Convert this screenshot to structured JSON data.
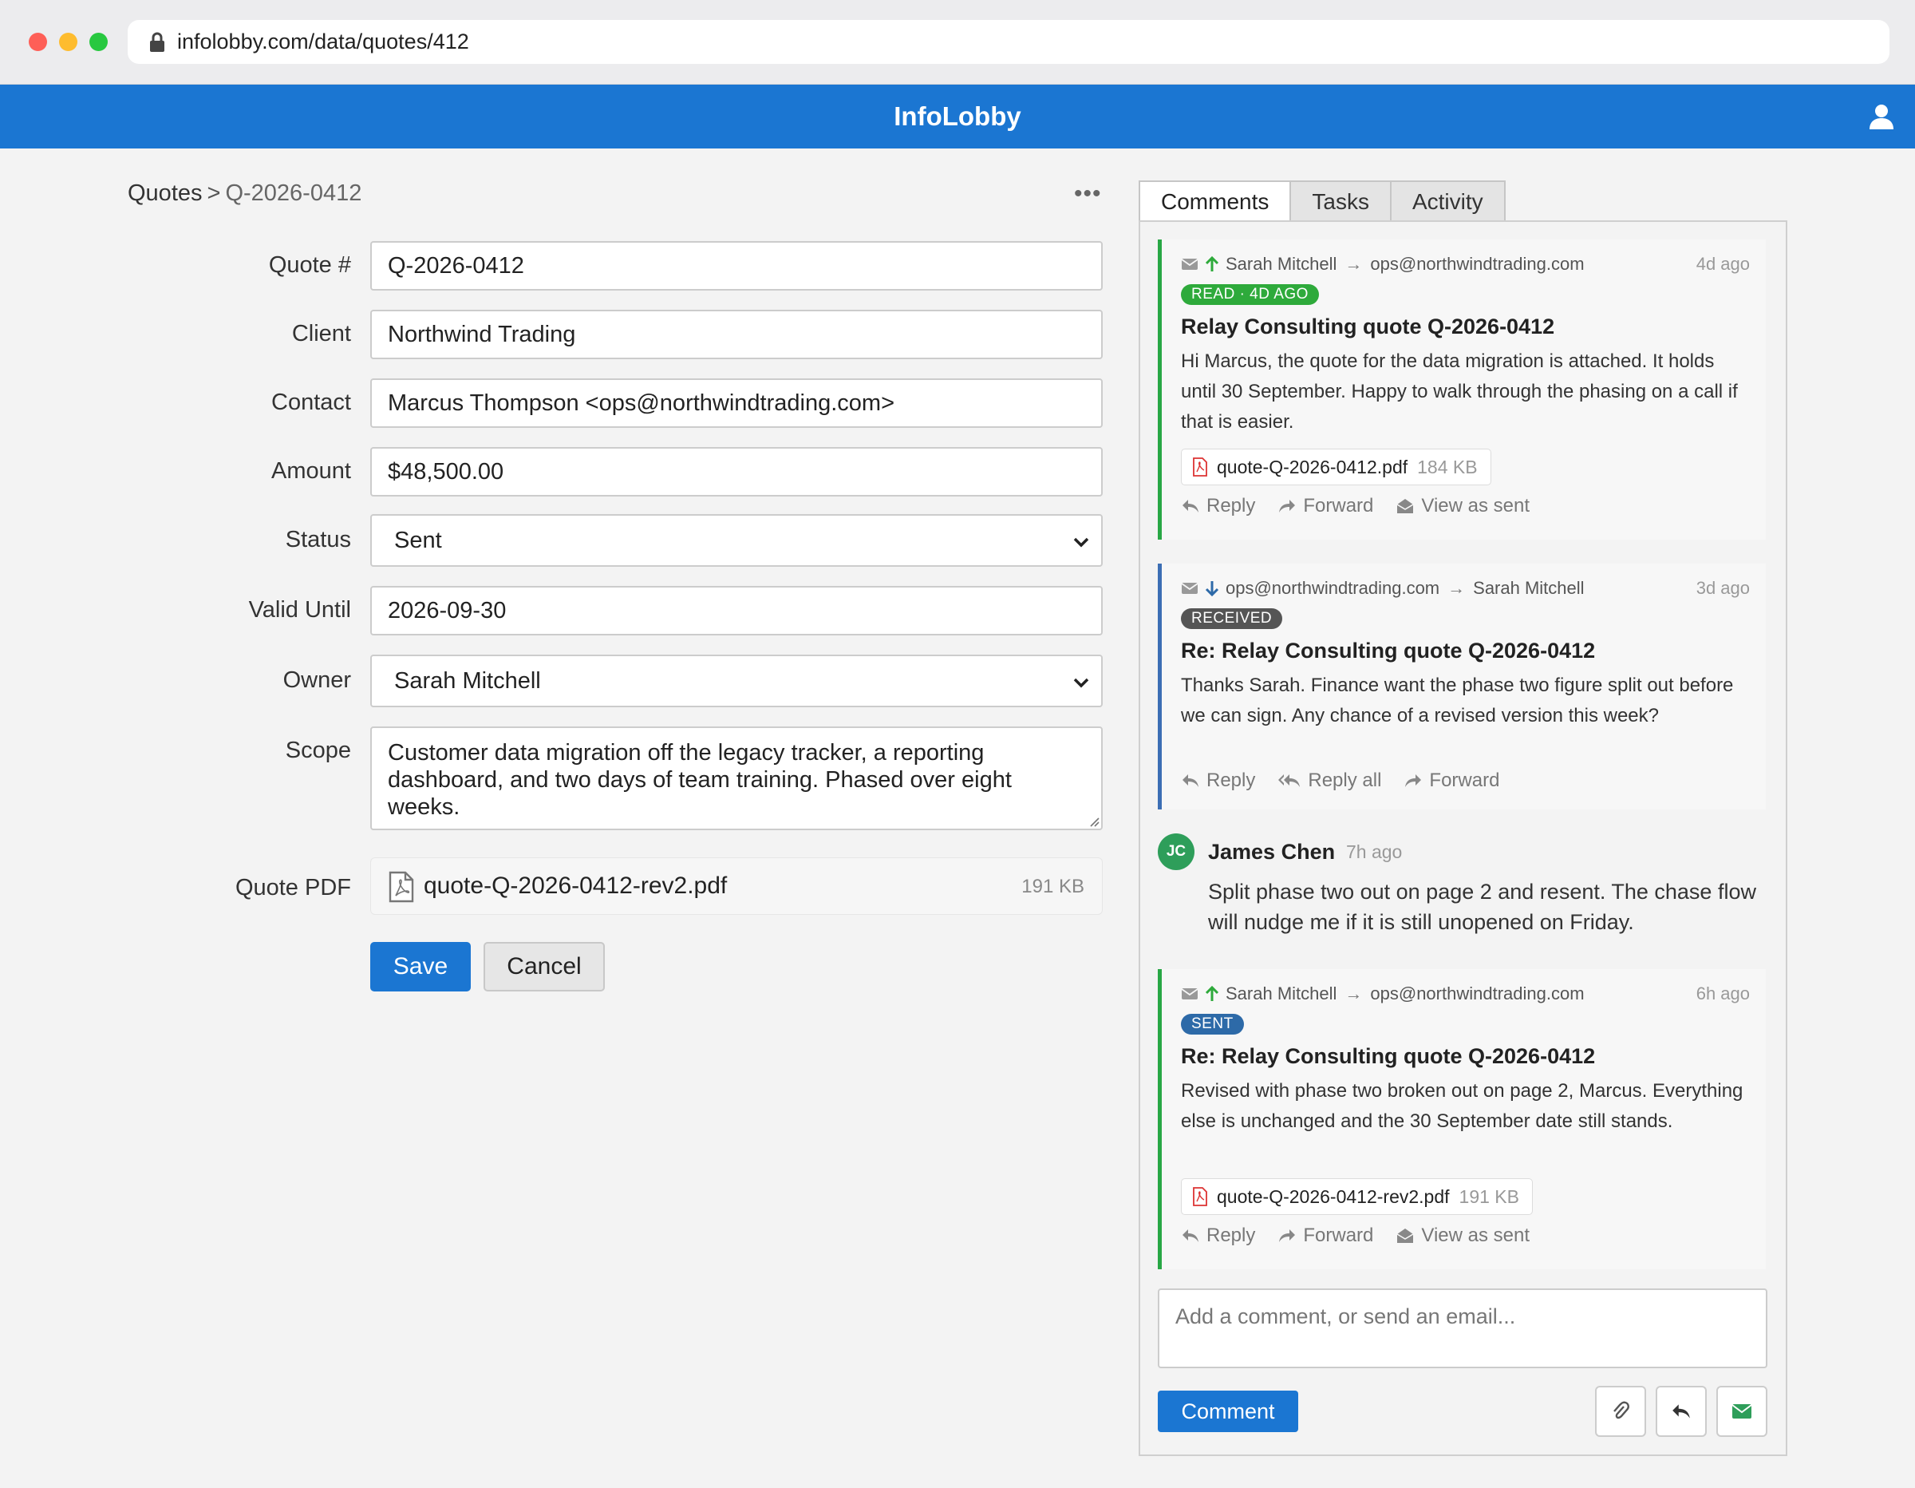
{
  "browser": {
    "url": "infolobby.com/data/quotes/412"
  },
  "app": {
    "title": "InfoLobby"
  },
  "breadcrumb": {
    "parent": "Quotes",
    "separator": ">",
    "current": "Q-2026-0412"
  },
  "form": {
    "quote_no": {
      "label": "Quote #",
      "value": "Q-2026-0412"
    },
    "client": {
      "label": "Client",
      "value": "Northwind Trading"
    },
    "contact": {
      "label": "Contact",
      "value": "Marcus Thompson <ops@northwindtrading.com>"
    },
    "amount": {
      "label": "Amount",
      "value": "$48,500.00"
    },
    "status": {
      "label": "Status",
      "value": "Sent"
    },
    "valid_until": {
      "label": "Valid Until",
      "value": "2026-09-30"
    },
    "owner": {
      "label": "Owner",
      "value": "Sarah Mitchell"
    },
    "scope": {
      "label": "Scope",
      "value": "Customer data migration off the legacy tracker, a reporting dashboard, and two days of team training. Phased over eight weeks."
    },
    "pdf": {
      "label": "Quote PDF",
      "filename": "quote-Q-2026-0412-rev2.pdf",
      "size": "191 KB"
    },
    "save_label": "Save",
    "cancel_label": "Cancel"
  },
  "tabs": [
    "Comments",
    "Tasks",
    "Activity"
  ],
  "feed": {
    "emails": [
      {
        "from": "Sarah Mitchell",
        "to": "ops@northwindtrading.com",
        "time": "4d ago",
        "badge": "READ · 4D AGO",
        "subject": "Relay Consulting quote Q-2026-0412",
        "body": "Hi Marcus, the quote for the data migration is attached. It holds until 30 September. Happy to walk through the phasing on a call if that is easier.",
        "attachment": {
          "name": "quote-Q-2026-0412.pdf",
          "size": "184 KB"
        },
        "actions": [
          "Reply",
          "Forward",
          "View as sent"
        ]
      },
      {
        "from": "ops@northwindtrading.com",
        "to": "Sarah Mitchell",
        "time": "3d ago",
        "badge": "RECEIVED",
        "subject": "Re: Relay Consulting quote Q-2026-0412",
        "body": "Thanks Sarah. Finance want the phase two figure split out before we can sign. Any chance of a revised version this week?",
        "actions": [
          "Reply",
          "Reply all",
          "Forward"
        ]
      },
      {
        "from": "Sarah Mitchell",
        "to": "ops@northwindtrading.com",
        "time": "6h ago",
        "badge": "SENT",
        "subject": "Re: Relay Consulting quote Q-2026-0412",
        "body": "Revised with phase two broken out on page 2, Marcus. Everything else is unchanged and the 30 September date still stands.",
        "attachment": {
          "name": "quote-Q-2026-0412-rev2.pdf",
          "size": "191 KB"
        },
        "actions": [
          "Reply",
          "Forward",
          "View as sent"
        ]
      }
    ],
    "comment": {
      "initials": "JC",
      "author": "James Chen",
      "time": "7h ago",
      "text": "Split phase two out on page 2 and resent. The chase flow will nudge me if it is still unopened on Friday."
    }
  },
  "composer": {
    "placeholder": "Add a comment, or send an email...",
    "button_label": "Comment"
  },
  "colors": {
    "brand": "#1b76d2",
    "read": "#2eaa3b",
    "sent": "#2d6aa8",
    "received": "#555555",
    "avatar": "#2e9e5a"
  }
}
